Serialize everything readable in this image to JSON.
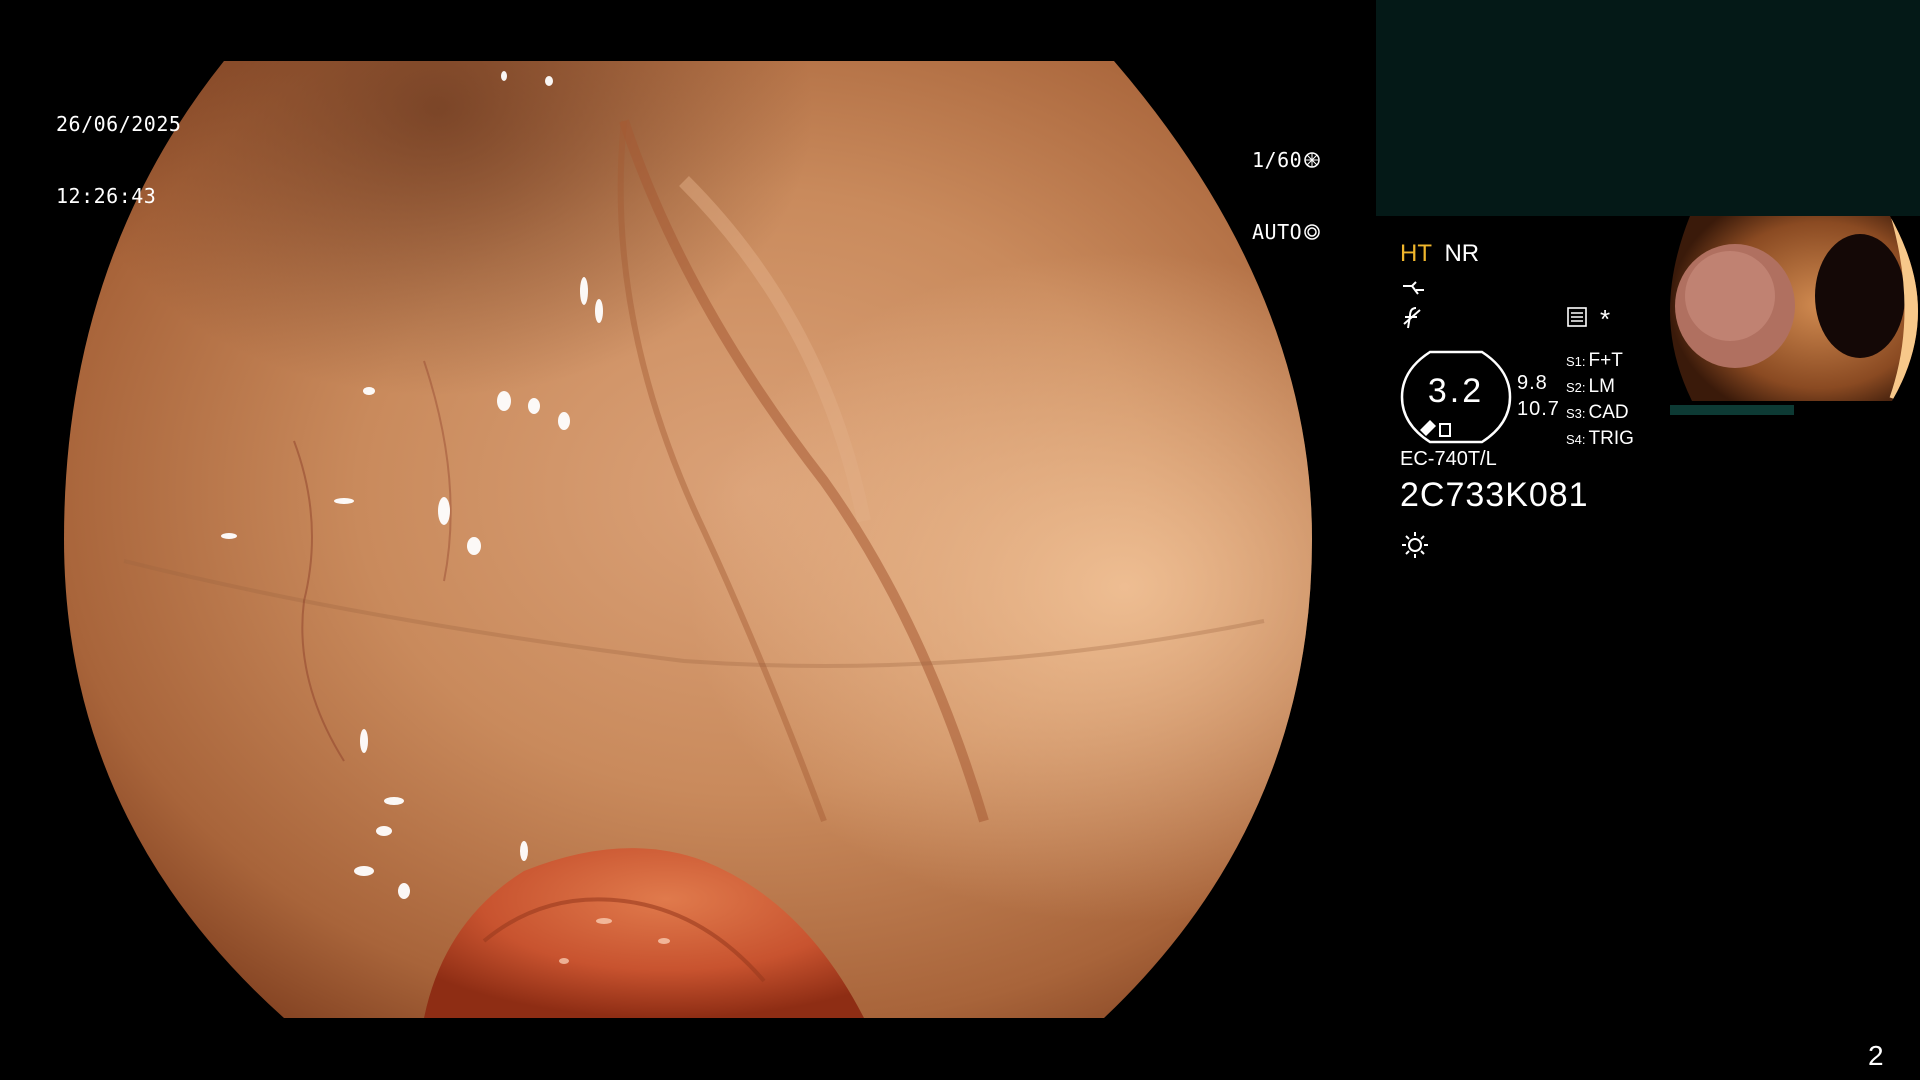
{
  "overlay": {
    "date": "26/06/2025",
    "time": "12:26:43",
    "shutter": "1/60",
    "exposure": "AUTO"
  },
  "status": {
    "mode_ht": "HT",
    "mode_nr": "NR",
    "asterisk": "*",
    "gauge_value": "3.2",
    "gauge_upper": "9.8",
    "gauge_lower": "10.7",
    "switches": [
      {
        "key": "S1:",
        "value": "F+T"
      },
      {
        "key": "S2:",
        "value": "LM"
      },
      {
        "key": "S3:",
        "value": "CAD"
      },
      {
        "key": "S4:",
        "value": "TRIG"
      }
    ],
    "scope_model": "EC-740T/L",
    "scope_serial": "2C733K081"
  },
  "page_number": "2",
  "icons": [
    "aperture-icon",
    "iris-icon",
    "enhancement-icon",
    "function-icon",
    "record-icon",
    "light-source-icon"
  ],
  "colors": {
    "background": "#000000",
    "reference_panel": "#041917",
    "mode_ht": "#f0b62c",
    "tissue_base": "#c98a5c",
    "lesion": "#c8532f"
  }
}
